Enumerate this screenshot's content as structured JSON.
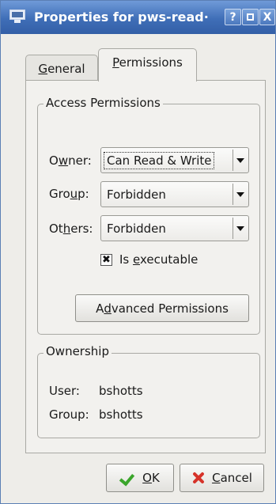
{
  "window": {
    "title": "Properties for pws-read·",
    "icon": "computer-icon",
    "controls": {
      "help": "?",
      "close": "X"
    }
  },
  "tabs": [
    {
      "label_pre": "",
      "mnemonic": "G",
      "label_post": "eneral",
      "active": false
    },
    {
      "label_pre": "",
      "mnemonic": "P",
      "label_post": "ermissions",
      "active": true
    }
  ],
  "access": {
    "legend": "Access Permissions",
    "owner": {
      "label_pre": "O",
      "mnemonic": "w",
      "label_post": "ner:",
      "value": "Can Read & Write"
    },
    "group": {
      "label_pre": "Gro",
      "mnemonic": "u",
      "label_post": "p:",
      "value": "Forbidden"
    },
    "others": {
      "label_pre": "Ot",
      "mnemonic": "h",
      "label_post": "ers:",
      "value": "Forbidden"
    },
    "executable": {
      "label_pre": "Is ",
      "mnemonic": "e",
      "label_post": "xecutable",
      "checked": true
    },
    "advanced": {
      "label_pre": "A",
      "mnemonic": "d",
      "label_post": "vanced Permissions"
    }
  },
  "ownership": {
    "legend": "Ownership",
    "user_label": "User:",
    "user_value": "bshotts",
    "group_label": "Group:",
    "group_value": "bshotts"
  },
  "buttons": {
    "ok": {
      "mnemonic": "O",
      "label_post": "K",
      "icon": "check-icon"
    },
    "cancel": {
      "mnemonic": "C",
      "label_post": "ancel",
      "icon": "cancel-x-icon"
    }
  }
}
